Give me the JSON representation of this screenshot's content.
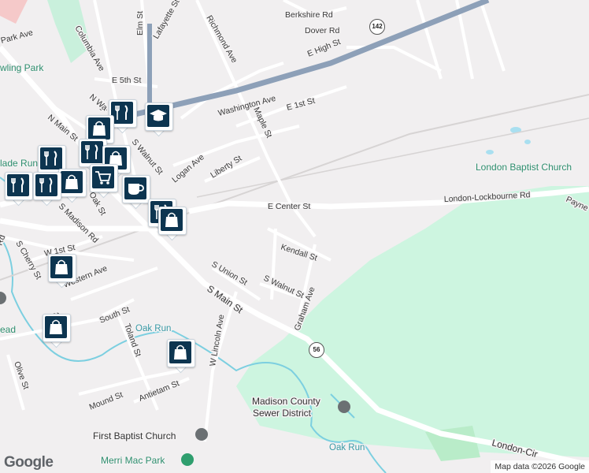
{
  "colors": {
    "background": "#f1eff0",
    "park": "#c9f0dc",
    "green_area": "#cdf5e0",
    "highway": "#8da0b8",
    "road": "#ffffff",
    "water": "#7ccfe0",
    "railway": "#d7d4d4",
    "pin_bg": "#0d3550"
  },
  "streets": {
    "e_high_st": "E High St",
    "elm_st": "Elm St",
    "lafayette_st": "Lafayette St",
    "richmond_ave": "Richmond Ave",
    "berkshire_rd": "Berkshire Rd",
    "dover_rd": "Dover Rd",
    "park_ave": "Park Ave",
    "columbia_ave": "Columbia Ave",
    "e_5th_st": "E 5th St",
    "n_main_st": "N Main St",
    "washington_ave": "Washington Ave",
    "e_1st_st": "E 1st St",
    "maple_st": "Maple St",
    "logan_ave": "Logan Ave",
    "liberty_st": "Liberty St",
    "s_walnut_st": "S Walnut St",
    "e_center_st": "E Center St",
    "london_lockbourne_rd": "London-Lockbourne Rd",
    "payne": "Payne",
    "kendall_st": "Kendall St",
    "s_union_st": "S Union St",
    "s_walnut_st_2": "S Walnut St",
    "graham_ave": "Graham Ave",
    "s_main_st": "S Main St",
    "s_madison_rd": "S Madison Rd",
    "oak_st": "Oak St",
    "w_1st_st": "W 1st St",
    "s_cherry_st": "S Cherry St",
    "western_ave": "Western Ave",
    "w_4th_st": "r St",
    "south_st": "South St",
    "toland_st": "Toland St",
    "w_lincoln_ave": "W Lincoln Ave",
    "olive_st": "Olive St",
    "mound_st": "Mound St",
    "antietam_st": "Antietam St",
    "london_cir": "London-Cir",
    "rd_frag": "Rd",
    "ead": "ead",
    "st_frag": "St",
    "n_wa": "N Wa"
  },
  "places": {
    "bowling_park": "wling Park",
    "glade_run": "lade Run",
    "london_baptist_church": "London Baptist Church",
    "oak_run": "Oak Run",
    "oak_run_2": "Oak Run",
    "madison_sewer_1": "Madison County",
    "madison_sewer_2": "Sewer District",
    "first_baptist_church": "First Baptist Church",
    "merri_mac_park": "Merri Mac Park"
  },
  "shields": {
    "route_142": "142",
    "route_56": "56"
  },
  "markers": [
    {
      "name": "restaurant-marker",
      "icon": "fork-knife-icon"
    },
    {
      "name": "school-marker",
      "icon": "graduation-cap-icon"
    },
    {
      "name": "shopping-bag-marker",
      "icon": "shopping-bag-icon"
    },
    {
      "name": "shopping-cart-marker",
      "icon": "shopping-cart-icon"
    },
    {
      "name": "cafe-marker",
      "icon": "coffee-cup-icon"
    }
  ],
  "attribution": {
    "logo": "Google",
    "map_data": "Map data ©2026 Google"
  }
}
